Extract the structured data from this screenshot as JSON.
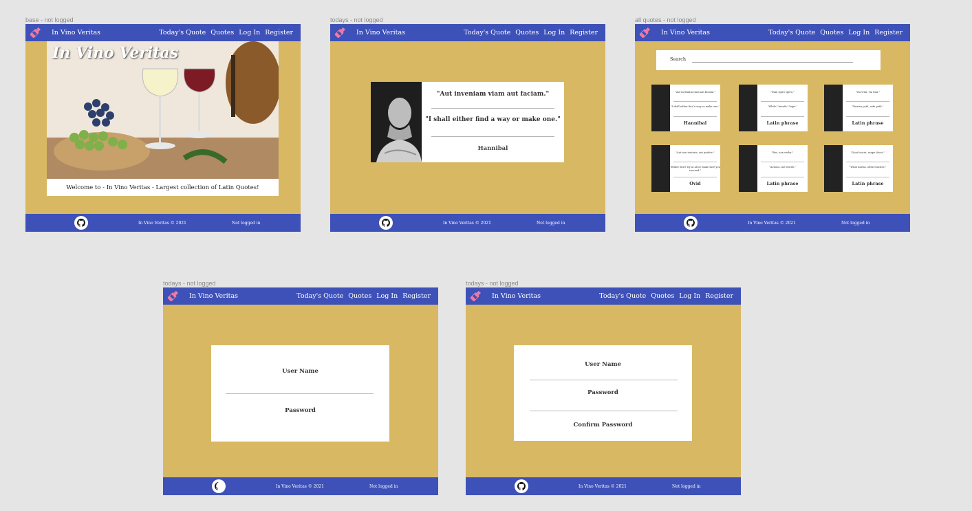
{
  "colors": {
    "nav_bar": "#3e51b8",
    "body_bg": "#d8b863",
    "logo_bottle": "#f07aa0",
    "canvas": "#e5e5e5"
  },
  "nav": {
    "brand": "In Vino Veritas",
    "links": [
      "Today's Quote",
      "Quotes",
      "Log In",
      "Register"
    ]
  },
  "footer": {
    "copyright": "In Vino Veritas © 2021",
    "status": "Not logged in",
    "icon": "github-icon"
  },
  "frames": {
    "base": {
      "label": "base - not logged"
    },
    "todays": {
      "label": "todays - not logged"
    },
    "all_quotes": {
      "label": "all quotes - not logged"
    },
    "login": {
      "label": "todays - not logged"
    },
    "register": {
      "label": "todays - not logged"
    }
  },
  "base": {
    "hero_title": "In Vino Veritas",
    "caption": "Welcome to - In Vino Veritas - Largest collection of Latin Quotes!"
  },
  "today": {
    "latin": "\"Aut inveniam viam aut faciam.\"",
    "english": "\"I shall either find a way or make one.\"",
    "author": "Hannibal"
  },
  "all_quotes": {
    "search_label": "Search",
    "cards": [
      {
        "latin": "\"Aut inveniam viam aut faciam.\"",
        "english": "\"I shall either find a way or make one.\"",
        "author": "Hannibal"
      },
      {
        "latin": "\"Dum spiro spero.\"",
        "english": "\"While I breath I hope.\"",
        "author": "Latin phrase"
      },
      {
        "latin": "\"Via trita, via tuta.\"",
        "english": "\"Beaten path, safe path.\"",
        "author": "Latin phrase"
      },
      {
        "latin": "\"Aut non tentaris, aut perfice.\"",
        "english": "\"Either don't try at all or make sure you succeed.\"",
        "author": "Ovid"
      },
      {
        "latin": "\"Res, non verba.\"",
        "english": "\"Actions, not words.\"",
        "author": "Latin phrase"
      },
      {
        "latin": "\"Quod nocet, saepe docet.\"",
        "english": "\"What harms, often teaches.\"",
        "author": "Latin phrase"
      }
    ]
  },
  "login": {
    "username": "User Name",
    "password": "Password"
  },
  "register": {
    "username": "User Name",
    "password": "Password",
    "confirm": "Confirm Password"
  }
}
